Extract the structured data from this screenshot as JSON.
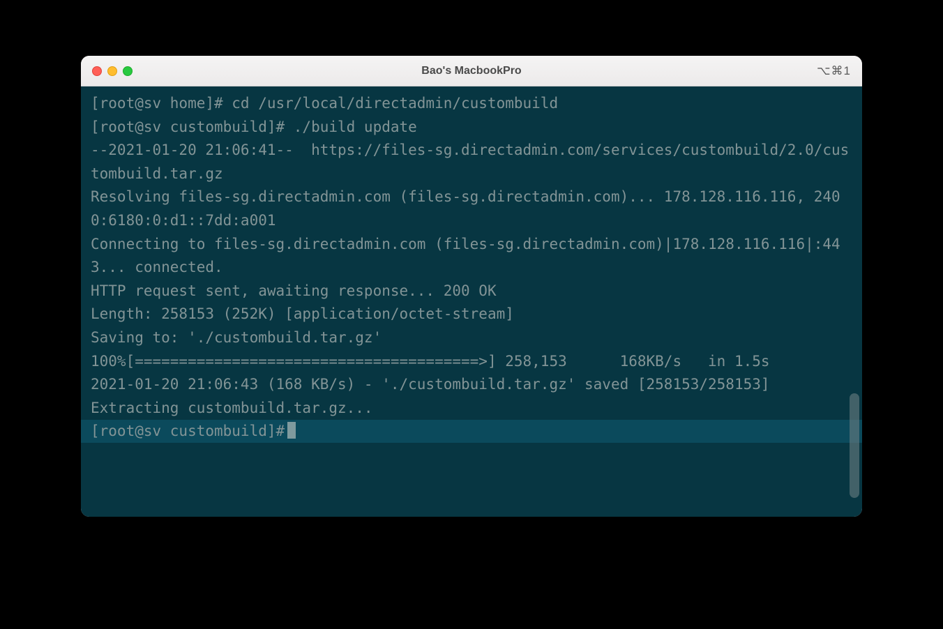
{
  "titlebar": {
    "title": "Bao's MacbookPro",
    "shortcut": "⌥⌘1"
  },
  "terminal": {
    "lines": [
      "[root@sv home]# cd /usr/local/directadmin/custombuild",
      "[root@sv custombuild]# ./build update",
      "--2021-01-20 21:06:41--  https://files-sg.directadmin.com/services/custombuild/2.0/custombuild.tar.gz",
      "Resolving files-sg.directadmin.com (files-sg.directadmin.com)... 178.128.116.116, 2400:6180:0:d1::7dd:a001",
      "Connecting to files-sg.directadmin.com (files-sg.directadmin.com)|178.128.116.116|:443... connected.",
      "HTTP request sent, awaiting response... 200 OK",
      "Length: 258153 (252K) [application/octet-stream]",
      "Saving to: './custombuild.tar.gz'",
      "",
      "100%[=======================================>] 258,153      168KB/s   in 1.5s",
      "",
      "2021-01-20 21:06:43 (168 KB/s) - './custombuild.tar.gz' saved [258153/258153]",
      "",
      "Extracting custombuild.tar.gz..."
    ],
    "final_prompt": "[root@sv custombuild]#"
  }
}
